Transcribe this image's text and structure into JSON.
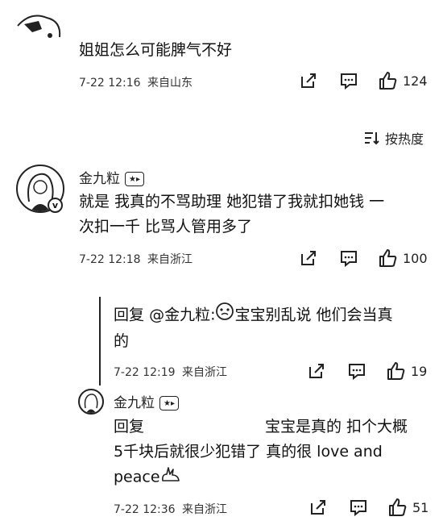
{
  "comments": [
    {
      "text": "姐姐怎么可能脾气不好",
      "time": "7-22 12:16",
      "location": "来自山东",
      "likes": "124"
    }
  ],
  "sort": {
    "label": "按热度"
  },
  "main_comment": {
    "user": "金九粒",
    "text_line1": "就是 我真的不骂助理 她犯错了我就扣她钱 一",
    "text_line2": "次扣一千 比骂人管用多了",
    "time": "7-22 12:18",
    "location": "来自浙江",
    "likes": "100"
  },
  "reply1": {
    "prefix": "回复",
    "mention": "@金九粒:",
    "text_line1_rest": "宝宝别乱说 他们会当真",
    "text_line2": "的",
    "time": "7-22 12:19",
    "location": "来自浙江",
    "likes": "19"
  },
  "reply2": {
    "user": "金九粒",
    "text_line1_start": "回复",
    "text_line1_end": "宝宝是真的 扣个大概",
    "text_line2": "5千块后就很少犯错了 真的很 love and",
    "text_line3": "peace",
    "time": "7-22 12:36",
    "location": "来自浙江",
    "likes": "51"
  }
}
